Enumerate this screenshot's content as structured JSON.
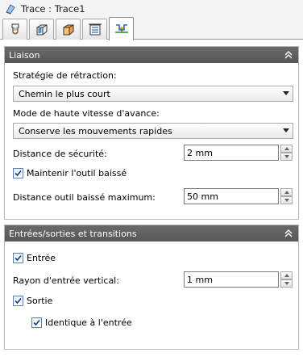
{
  "window": {
    "title": "Trace : Trace1",
    "title_icon": "trace-icon"
  },
  "tabs": [
    {
      "icon": "tool-icon",
      "active": false
    },
    {
      "icon": "cube-outline-icon",
      "active": false
    },
    {
      "icon": "stock-cube-icon",
      "active": false
    },
    {
      "icon": "heights-icon",
      "active": false
    },
    {
      "icon": "linking-icon",
      "active": true
    }
  ],
  "liaison": {
    "header": "Liaison",
    "retract_label": "Stratégie de rétraction:",
    "retract_value": "Chemin le plus court",
    "rapid_label": "Mode de haute vitesse d'avance:",
    "rapid_value": "Conserve les mouvements rapides",
    "safe_distance_label": "Distance de sécurité:",
    "safe_distance_value": "2 mm",
    "keep_tool_down_label": "Maintenir l'outil baissé",
    "keep_tool_down_checked": true,
    "max_stay_down_label": "Distance outil baissé maximum:",
    "max_stay_down_value": "50 mm"
  },
  "leads": {
    "header": "Entrées/sorties et transitions",
    "entry_label": "Entrée",
    "entry_checked": true,
    "vertical_radius_label": "Rayon d'entrée vertical:",
    "vertical_radius_value": "1 mm",
    "exit_label": "Sortie",
    "exit_checked": true,
    "same_as_entry_label": "Identique à l'entrée",
    "same_as_entry_checked": true
  }
}
